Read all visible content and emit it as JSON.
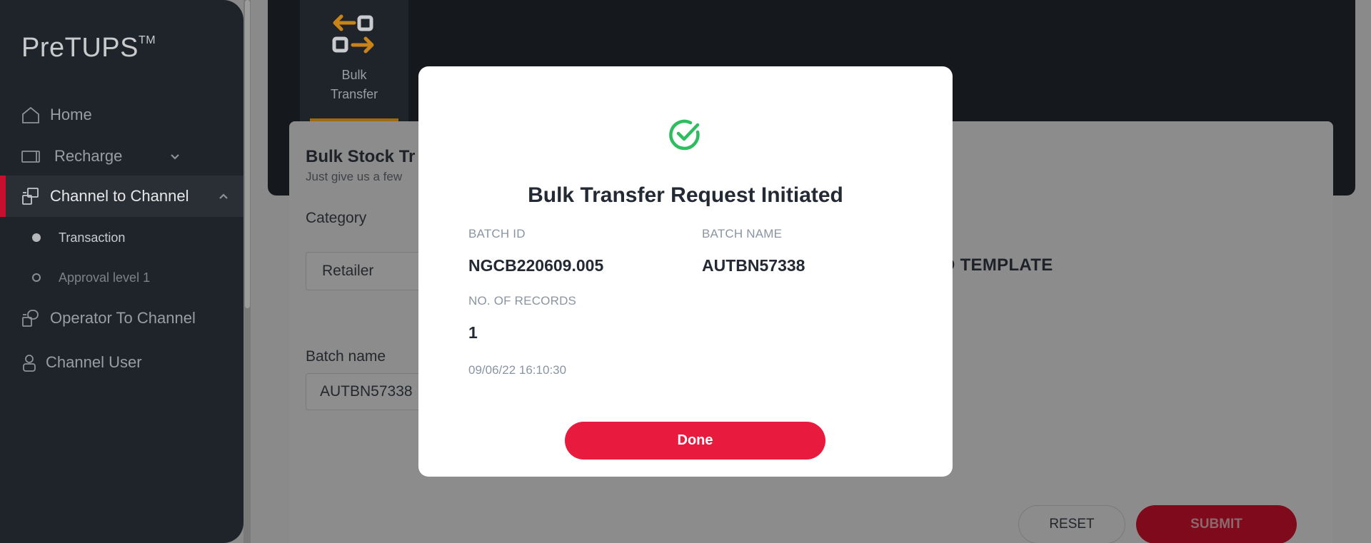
{
  "app": {
    "logo": "PreTUPS",
    "logo_tm": "TM"
  },
  "sidebar": {
    "items": [
      {
        "label": "Home",
        "icon": "home-icon"
      },
      {
        "label": "Recharge",
        "icon": "ticket-icon"
      },
      {
        "label": "Channel to Channel",
        "icon": "transfer-icon"
      },
      {
        "label": "Operator To Channel",
        "icon": "transfer-icon"
      },
      {
        "label": "Channel User",
        "icon": "user-icon"
      }
    ],
    "subitems": [
      {
        "label": "Transaction",
        "state": "selected"
      },
      {
        "label": "Approval level 1",
        "state": "unselected"
      }
    ]
  },
  "header": {
    "tile_label_line1": "Bulk",
    "tile_label_line2": "Transfer"
  },
  "form": {
    "title": "Bulk Stock Tr",
    "subtitle": "Just give us a few",
    "category_label": "Category",
    "category_value": "Retailer",
    "batch_name_label": "Batch name",
    "batch_name_value": "AUTBN57338",
    "template_text": "D TEMPLATE",
    "reset_label": "RESET",
    "submit_label": "SUBMIT"
  },
  "modal": {
    "title": "Bulk Transfer Request Initiated",
    "batch_id_label": "BATCH ID",
    "batch_id_value": "NGCB220609.005",
    "batch_name_label": "BATCH NAME",
    "batch_name_value": "AUTBN57338",
    "records_label": "NO. OF RECORDS",
    "records_value": "1",
    "timestamp": "09/06/22 16:10:30",
    "done_label": "Done"
  },
  "colors": {
    "accent": "#e81a3e",
    "success": "#2ebd5f",
    "sidebar": "#1f242b",
    "tile_icon": "#c8841a"
  }
}
